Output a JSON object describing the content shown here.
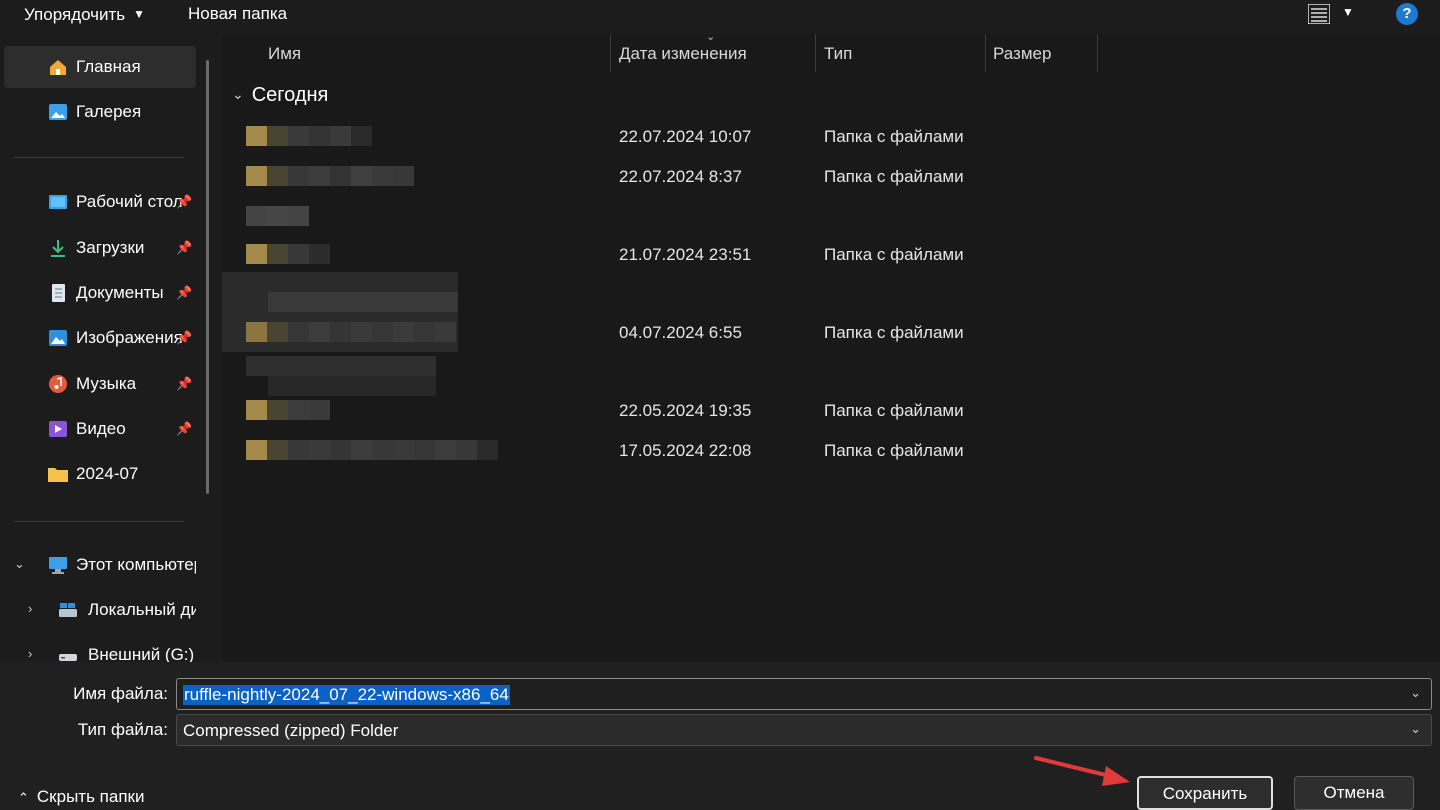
{
  "toolbar": {
    "organize_label": "Упорядочить",
    "new_folder_label": "Новая папка",
    "help_label": "?"
  },
  "sidebar": {
    "home": "Главная",
    "gallery": "Галерея",
    "pinned": [
      {
        "label": "Рабочий стол",
        "icon": "desktop-icon"
      },
      {
        "label": "Загрузки",
        "icon": "download-icon"
      },
      {
        "label": "Документы",
        "icon": "document-icon"
      },
      {
        "label": "Изображения",
        "icon": "pictures-icon"
      },
      {
        "label": "Музыка",
        "icon": "music-icon"
      },
      {
        "label": "Видео",
        "icon": "video-icon"
      }
    ],
    "folder_2024_07": "2024-07",
    "this_pc": "Этот компьютер",
    "local_disk": "Локальный диск",
    "external_disk": "Внешний (G:)"
  },
  "columns": {
    "name": "Имя",
    "date": "Дата изменения",
    "type": "Тип",
    "size": "Размер"
  },
  "group": {
    "label": "Сегодня"
  },
  "rows": [
    {
      "date": "22.07.2024 10:07",
      "type": "Папка с файлами"
    },
    {
      "date": "22.07.2024 8:37",
      "type": "Папка с файлами"
    },
    {
      "date": "21.07.2024 23:51",
      "type": "Папка с файлами"
    },
    {
      "date": "04.07.2024 6:55",
      "type": "Папка с файлами"
    },
    {
      "date": "22.05.2024 19:35",
      "type": "Папка с файлами"
    },
    {
      "date": "17.05.2024 22:08",
      "type": "Папка с файлами"
    }
  ],
  "filename": {
    "label": "Имя файла:",
    "value": "ruffle-nightly-2024_07_22-windows-x86_64"
  },
  "filetype": {
    "label": "Тип файла:",
    "value": "Compressed (zipped) Folder"
  },
  "footer": {
    "hide_folders": "Скрыть папки",
    "save": "Сохранить",
    "cancel": "Отмена"
  },
  "colors": {
    "background": "#191919",
    "selection": "#0a62c4",
    "folder": "#e8b84a",
    "accent_arrow": "#e03a3a"
  }
}
